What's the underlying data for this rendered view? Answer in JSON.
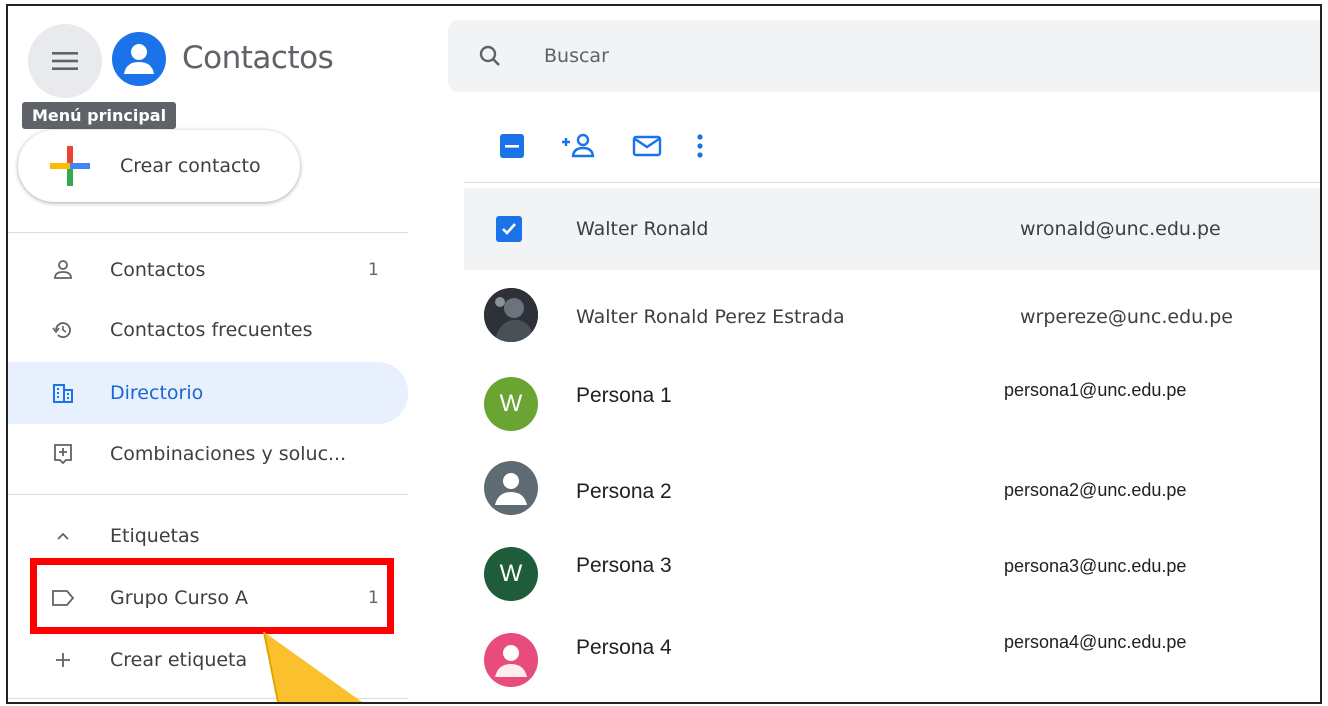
{
  "app": {
    "title": "Contactos",
    "menu_tooltip": "Menú principal"
  },
  "sidebar": {
    "create_label": "Crear contacto",
    "items": [
      {
        "label": "Contactos",
        "count": "1",
        "icon": "person-outline-icon"
      },
      {
        "label": "Contactos frecuentes",
        "count": "",
        "icon": "history-icon"
      },
      {
        "label": "Directorio",
        "count": "",
        "icon": "domain-icon",
        "active": true
      },
      {
        "label": "Combinaciones y soluc...",
        "count": "",
        "icon": "merge-icon"
      }
    ],
    "labels_header": "Etiquetas",
    "label_items": [
      {
        "label": "Grupo Curso A",
        "count": "1",
        "icon": "label-outline-icon"
      }
    ],
    "create_label_text": "Crear etiqueta"
  },
  "search": {
    "placeholder": "Buscar"
  },
  "toolbar": {
    "icons": [
      "deselect-checkbox-icon",
      "add-to-label-icon",
      "email-icon",
      "more-vert-icon"
    ]
  },
  "contacts": [
    {
      "name": "Walter Ronald",
      "email": "wronald@unc.edu.pe",
      "selected": true
    },
    {
      "name": "Walter Ronald Perez Estrada",
      "email": "wrpereze@unc.edu.pe",
      "avatar": "photo"
    },
    {
      "name": "Persona 1",
      "email": "persona1@unc.edu.pe",
      "avatar_letter": "W",
      "avatar_color": "#6aa534"
    },
    {
      "name": "Persona 2",
      "email": "persona2@unc.edu.pe",
      "avatar": "default",
      "avatar_color": "#5f6b73"
    },
    {
      "name": "Persona 3",
      "email": "persona3@unc.edu.pe",
      "avatar_letter": "W",
      "avatar_color": "#1e5c3a"
    },
    {
      "name": "Persona 4",
      "email": "persona4@unc.edu.pe",
      "avatar": "default",
      "avatar_color": "#e84c7c"
    }
  ],
  "colors": {
    "accent": "#1a73e8",
    "highlight_box": "#ff0000",
    "arrow": "#fbc02d"
  }
}
